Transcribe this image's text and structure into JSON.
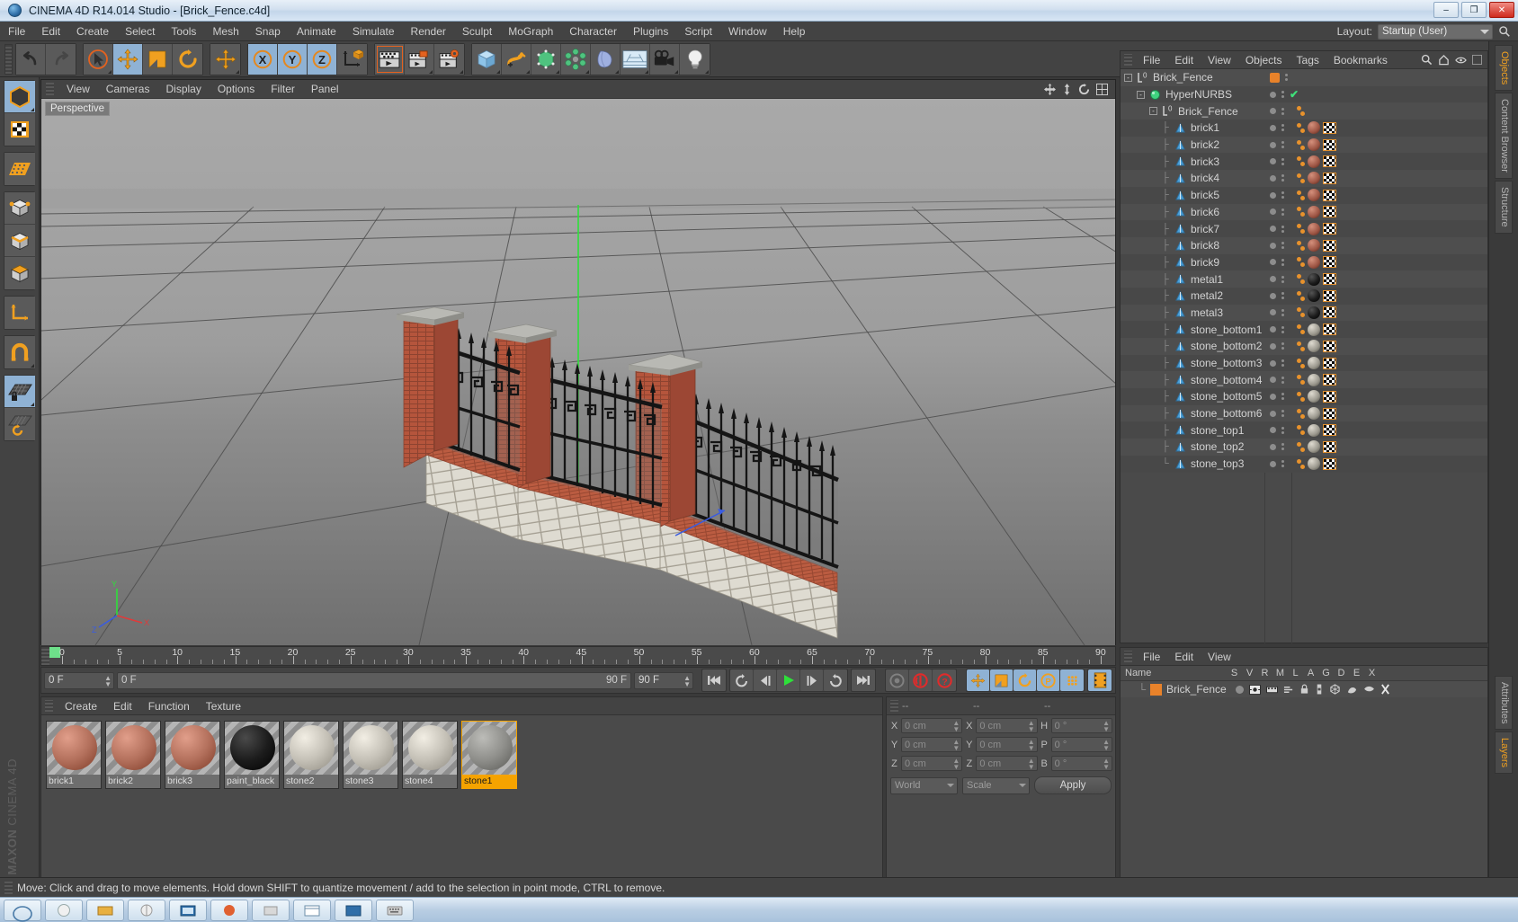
{
  "window": {
    "title": "CINEMA 4D R14.014 Studio - [Brick_Fence.c4d]",
    "minimize": "–",
    "maximize": "❐",
    "close": "✕"
  },
  "menubar": {
    "items": [
      "File",
      "Edit",
      "Create",
      "Select",
      "Tools",
      "Mesh",
      "Snap",
      "Animate",
      "Simulate",
      "Render",
      "Sculpt",
      "MoGraph",
      "Character",
      "Plugins",
      "Script",
      "Window",
      "Help"
    ],
    "layout_label": "Layout:",
    "layout_value": "Startup (User)"
  },
  "toolbar": {
    "undo": "undo",
    "redo": "redo",
    "select": "live-selection",
    "move": "move",
    "scale": "scale",
    "rotate": "rotate",
    "move2": "move-alt",
    "axis_x": "X",
    "axis_y": "Y",
    "axis_z": "Z",
    "world_axis": "world-coordinate-system",
    "render_view": "render-view",
    "render_region": "render-region",
    "render_settings": "render-settings",
    "cube": "add-cube",
    "spline": "add-spline",
    "nurbs": "add-hypernurbs",
    "array": "add-array",
    "deformer": "add-deformer",
    "scene": "add-scene",
    "camera": "add-camera",
    "light": "add-light"
  },
  "lefttoolbar": {
    "items": [
      {
        "name": "model-mode",
        "selected": true
      },
      {
        "name": "texture-mode",
        "selected": false
      },
      {
        "name": "points-mode",
        "selected": false
      },
      {
        "name": "edges-mode",
        "selected": false
      },
      {
        "name": "polygons-mode",
        "selected": false
      },
      {
        "name": "object-axis-mode",
        "selected": false
      },
      {
        "name": "world-object-axis",
        "selected": false
      },
      {
        "name": "enable-snapping",
        "selected": false
      },
      {
        "name": "lock-workplane",
        "selected": true
      },
      {
        "name": "workplane-rotate",
        "selected": false
      }
    ]
  },
  "viewport": {
    "menu": [
      "View",
      "Cameras",
      "Display",
      "Options",
      "Filter",
      "Panel"
    ],
    "label": "Perspective",
    "axis_labels": {
      "x": "X",
      "y": "Y",
      "z": "Z"
    }
  },
  "timeline": {
    "ticks": [
      0,
      5,
      10,
      15,
      20,
      25,
      30,
      35,
      40,
      45,
      50,
      55,
      60,
      65,
      70,
      75,
      80,
      85,
      90
    ],
    "current_frame": "0 F",
    "range_start": "0 F",
    "range_end": "90 F",
    "end_frame": "90 F",
    "preview_end": "90 F",
    "playback": {
      "go_to_start": "go-to-start",
      "step_back_keyframe": "previous-keyframe",
      "step_back": "step-back",
      "play": "play",
      "step_forward": "step-forward",
      "next_keyframe": "next-keyframe",
      "go_to_end": "go-to-end",
      "record": "record-active-objects",
      "autokey": "autokeying",
      "keyframe_selection": "keyframe-selection",
      "pos": "position",
      "scale": "scale",
      "rot": "rotation",
      "param": "parameter",
      "pla": "point-level-animation",
      "timeline_view": "timeline"
    }
  },
  "materials": {
    "menu": [
      "Create",
      "Edit",
      "Function",
      "Texture"
    ],
    "items": [
      {
        "name": "brick1",
        "color": "#b3705c",
        "selected": false
      },
      {
        "name": "brick2",
        "color": "#b3705c",
        "selected": false
      },
      {
        "name": "brick3",
        "color": "#b3705c",
        "selected": false
      },
      {
        "name": "paint_black",
        "color": "#1c1c1c",
        "selected": false
      },
      {
        "name": "stone2",
        "color": "#c4c0b6",
        "selected": false
      },
      {
        "name": "stone3",
        "color": "#c4c0b6",
        "selected": false
      },
      {
        "name": "stone4",
        "color": "#c4c0b6",
        "selected": false
      },
      {
        "name": "stone1",
        "color": "#8e8e8a",
        "selected": true
      }
    ]
  },
  "coordinates": {
    "header": [
      "--",
      "--",
      "--"
    ],
    "rows": [
      {
        "a1": "X",
        "v1": "0 cm",
        "a2": "X",
        "v2": "0 cm",
        "a3": "H",
        "v3": "0 °"
      },
      {
        "a1": "Y",
        "v1": "0 cm",
        "a2": "Y",
        "v2": "0 cm",
        "a3": "P",
        "v3": "0 °"
      },
      {
        "a1": "Z",
        "v1": "0 cm",
        "a2": "Z",
        "v2": "0 cm",
        "a3": "B",
        "v3": "0 °"
      }
    ],
    "system": "World",
    "mode": "Scale",
    "apply": "Apply"
  },
  "objects": {
    "menu": [
      "File",
      "Edit",
      "View",
      "Objects",
      "Tags",
      "Bookmarks"
    ],
    "icons": [
      "search-icon",
      "home-icon",
      "eye-icon"
    ],
    "rows": [
      {
        "label": "Brick_Fence",
        "depth": 0,
        "icon": "null-object",
        "expander": "-",
        "dot": "orange",
        "tags": [],
        "check": false
      },
      {
        "label": "HyperNURBS",
        "depth": 1,
        "icon": "hypernurbs",
        "expander": "-",
        "dot": "grey",
        "tags": [],
        "check": true
      },
      {
        "label": "Brick_Fence",
        "depth": 2,
        "icon": "null-object",
        "expander": "-",
        "dot": "grey",
        "tags": [
          "dots"
        ],
        "check": false
      },
      {
        "label": "brick1",
        "depth": 3,
        "icon": "polygon-object",
        "expander": "",
        "dot": "grey",
        "tags": [
          "dots",
          "mat-brick",
          "uv"
        ],
        "check": false
      },
      {
        "label": "brick2",
        "depth": 3,
        "icon": "polygon-object",
        "expander": "",
        "dot": "grey",
        "tags": [
          "dots",
          "mat-brick",
          "uv"
        ],
        "check": false
      },
      {
        "label": "brick3",
        "depth": 3,
        "icon": "polygon-object",
        "expander": "",
        "dot": "grey",
        "tags": [
          "dots",
          "mat-brick",
          "uv"
        ],
        "check": false
      },
      {
        "label": "brick4",
        "depth": 3,
        "icon": "polygon-object",
        "expander": "",
        "dot": "grey",
        "tags": [
          "dots",
          "mat-brick",
          "uv"
        ],
        "check": false
      },
      {
        "label": "brick5",
        "depth": 3,
        "icon": "polygon-object",
        "expander": "",
        "dot": "grey",
        "tags": [
          "dots",
          "mat-brick",
          "uv"
        ],
        "check": false
      },
      {
        "label": "brick6",
        "depth": 3,
        "icon": "polygon-object",
        "expander": "",
        "dot": "grey",
        "tags": [
          "dots",
          "mat-brick",
          "uv"
        ],
        "check": false
      },
      {
        "label": "brick7",
        "depth": 3,
        "icon": "polygon-object",
        "expander": "",
        "dot": "grey",
        "tags": [
          "dots",
          "mat-brick",
          "uv"
        ],
        "check": false
      },
      {
        "label": "brick8",
        "depth": 3,
        "icon": "polygon-object",
        "expander": "",
        "dot": "grey",
        "tags": [
          "dots",
          "mat-brick",
          "uv"
        ],
        "check": false
      },
      {
        "label": "brick9",
        "depth": 3,
        "icon": "polygon-object",
        "expander": "",
        "dot": "grey",
        "tags": [
          "dots",
          "mat-brick",
          "uv"
        ],
        "check": false
      },
      {
        "label": "metal1",
        "depth": 3,
        "icon": "polygon-object",
        "expander": "",
        "dot": "grey",
        "tags": [
          "dots",
          "mat-black",
          "uv"
        ],
        "check": false
      },
      {
        "label": "metal2",
        "depth": 3,
        "icon": "polygon-object",
        "expander": "",
        "dot": "grey",
        "tags": [
          "dots",
          "mat-black",
          "uv"
        ],
        "check": false
      },
      {
        "label": "metal3",
        "depth": 3,
        "icon": "polygon-object",
        "expander": "",
        "dot": "grey",
        "tags": [
          "dots",
          "mat-black",
          "uv"
        ],
        "check": false
      },
      {
        "label": "stone_bottom1",
        "depth": 3,
        "icon": "polygon-object",
        "expander": "",
        "dot": "grey",
        "tags": [
          "dots",
          "mat-stone",
          "uv"
        ],
        "check": false
      },
      {
        "label": "stone_bottom2",
        "depth": 3,
        "icon": "polygon-object",
        "expander": "",
        "dot": "grey",
        "tags": [
          "dots",
          "mat-stone",
          "uv"
        ],
        "check": false
      },
      {
        "label": "stone_bottom3",
        "depth": 3,
        "icon": "polygon-object",
        "expander": "",
        "dot": "grey",
        "tags": [
          "dots",
          "mat-stone",
          "uv"
        ],
        "check": false
      },
      {
        "label": "stone_bottom4",
        "depth": 3,
        "icon": "polygon-object",
        "expander": "",
        "dot": "grey",
        "tags": [
          "dots",
          "mat-stone",
          "uv"
        ],
        "check": false
      },
      {
        "label": "stone_bottom5",
        "depth": 3,
        "icon": "polygon-object",
        "expander": "",
        "dot": "grey",
        "tags": [
          "dots",
          "mat-stone",
          "uv"
        ],
        "check": false
      },
      {
        "label": "stone_bottom6",
        "depth": 3,
        "icon": "polygon-object",
        "expander": "",
        "dot": "grey",
        "tags": [
          "dots",
          "mat-stone",
          "uv"
        ],
        "check": false
      },
      {
        "label": "stone_top1",
        "depth": 3,
        "icon": "polygon-object",
        "expander": "",
        "dot": "grey",
        "tags": [
          "dots",
          "mat-stone",
          "uv"
        ],
        "check": false
      },
      {
        "label": "stone_top2",
        "depth": 3,
        "icon": "polygon-object",
        "expander": "",
        "dot": "grey",
        "tags": [
          "dots",
          "mat-stone",
          "uv"
        ],
        "check": false
      },
      {
        "label": "stone_top3",
        "depth": 3,
        "icon": "polygon-object",
        "expander": "",
        "dot": "grey",
        "tags": [
          "dots",
          "mat-stone",
          "uv"
        ],
        "check": false
      }
    ]
  },
  "layers": {
    "menu": [
      "File",
      "Edit",
      "View"
    ],
    "columns": [
      "Name",
      "S",
      "V",
      "R",
      "M",
      "L",
      "A",
      "G",
      "D",
      "E",
      "X"
    ],
    "rows": [
      {
        "name": "Brick_Fence",
        "color": "#e8822a"
      }
    ]
  },
  "vtabs": {
    "top": [
      "Objects",
      "Content Browser",
      "Structure"
    ],
    "bottom": [
      "Attributes",
      "Layers"
    ]
  },
  "statusbar": {
    "text": "Move: Click and drag to move elements. Hold down SHIFT to quantize movement / add to the selection in point mode, CTRL to remove."
  }
}
